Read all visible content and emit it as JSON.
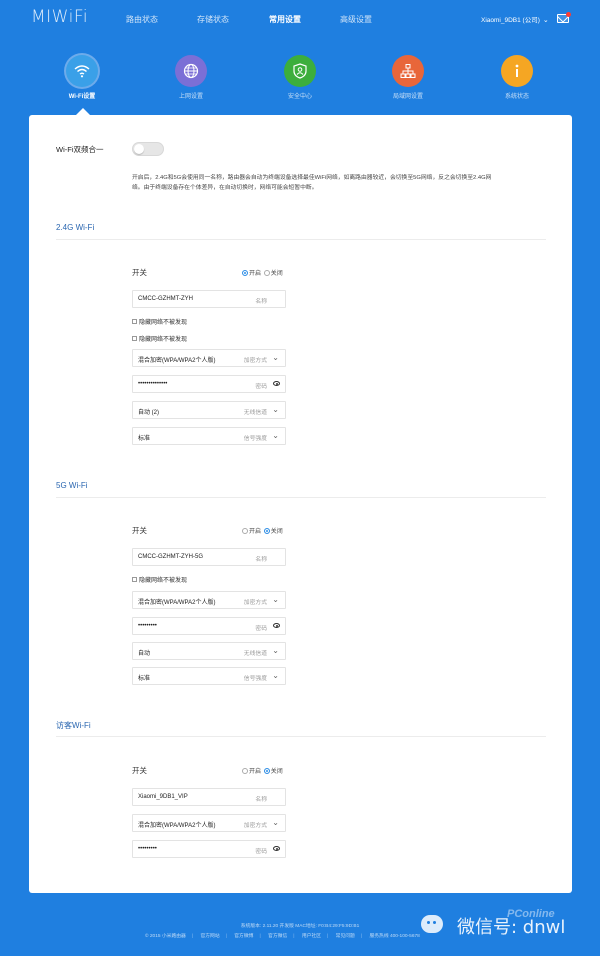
{
  "app": {
    "logo": "MIWiFi"
  },
  "nav": {
    "items": [
      {
        "label": "路由状态"
      },
      {
        "label": "存储状态"
      },
      {
        "label": "常用设置"
      },
      {
        "label": "高级设置"
      }
    ],
    "router_name": "Xiaomi_9DB1 (公司)"
  },
  "subnav": {
    "items": [
      {
        "label": "Wi-Fi设置",
        "icon": "wifi-icon",
        "color": "#3aa0e8"
      },
      {
        "label": "上网设置",
        "icon": "globe-icon",
        "color": "#7b6fd6"
      },
      {
        "label": "安全中心",
        "icon": "shield-icon",
        "color": "#3cae3c"
      },
      {
        "label": "局域网设置",
        "icon": "network-icon",
        "color": "#e8663a"
      },
      {
        "label": "系统状态",
        "icon": "info-icon",
        "color": "#f5a623"
      }
    ]
  },
  "dual_band": {
    "label": "Wi-Fi双频合一",
    "enabled": false,
    "desc_line1": "开启后，2.4G和5G会使用同一名称，路由器会自动为终端设备选择最佳WiFi网络，如离路由器较近，会切换至5G网络，反之会切换至2.4G网",
    "desc_line2": "络。由于终端设备存在个体差异，在自动切换时，网络可能会短暂中断。"
  },
  "radio_labels": {
    "on": "开启",
    "off": "关闭"
  },
  "wifi24": {
    "title": "2.4G Wi-Fi",
    "switch_label": "开关",
    "enabled": true,
    "ssid": "CMCC-GZHMT-ZYH",
    "ssid_hint": "名称",
    "hide_label": "隐藏网络不被发现",
    "hide_label_2": "隐藏网络不被发现",
    "encryption": "混合加密(WPA/WPA2个人版)",
    "encryption_hint": "加密方式",
    "password": "••••••••••••••",
    "password_hint": "密码",
    "channel": "自动 (2)",
    "channel_hint": "无线信道",
    "signal": "标准",
    "signal_hint": "信号强度"
  },
  "wifi5": {
    "title": "5G Wi-Fi",
    "switch_label": "开关",
    "enabled": false,
    "ssid": "CMCC-GZHMT-ZYH-5G",
    "ssid_hint": "名称",
    "hide_label": "隐藏网络不被发现",
    "encryption": "混合加密(WPA/WPA2个人版)",
    "encryption_hint": "加密方式",
    "password": "•••••••••",
    "password_hint": "密码",
    "channel": "自动",
    "channel_hint": "无线信道",
    "signal": "标准",
    "signal_hint": "信号强度"
  },
  "guest": {
    "title": "访客Wi-Fi",
    "switch_label": "开关",
    "enabled": false,
    "ssid": "Xiaomi_9DB1_VIP",
    "ssid_hint": "名称",
    "encryption": "混合加密(WPA/WPA2个人版)",
    "encryption_hint": "加密方式",
    "password": "•••••••••",
    "password_hint": "密码"
  },
  "footer": {
    "line1": "系统版本: 2.11.20 开发版  MAC地址: F0:B4:29:F5:9D:B1",
    "links": [
      "© 2015 小米路由器",
      "官方网站",
      "官方微博",
      "官方微信",
      "用户社区",
      "常见问题",
      "服务热线 400-100-5678"
    ]
  },
  "watermark": {
    "text": "微信号: dnwl",
    "pconline": "PConline"
  }
}
